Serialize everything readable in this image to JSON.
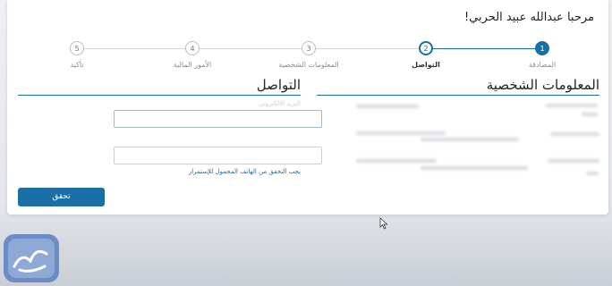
{
  "greeting": "مرحبا عبدالله عبيد الحربي!",
  "steps": [
    {
      "number": "1",
      "label": "المصادقة"
    },
    {
      "number": "2",
      "label": "التواصل"
    },
    {
      "number": "3",
      "label": "المعلومات الشخصية"
    },
    {
      "number": "4",
      "label": "الأمور المالية"
    },
    {
      "number": "5",
      "label": "تأكيد"
    }
  ],
  "current_step": 2,
  "personal_info": {
    "title": "المعلومات الشخصية"
  },
  "contact": {
    "title": "التواصل",
    "field_label": "البريد الالكتروني",
    "hint": "يجب التحقق من الهاتف المحمول للإستمرار",
    "submit_label": "تحقق"
  },
  "colors": {
    "accent": "#1a6fa6",
    "logo": "#6d8bc4"
  },
  "icons": {
    "cursor": "mouse-pointer-icon",
    "logo": "site-logo-icon"
  }
}
